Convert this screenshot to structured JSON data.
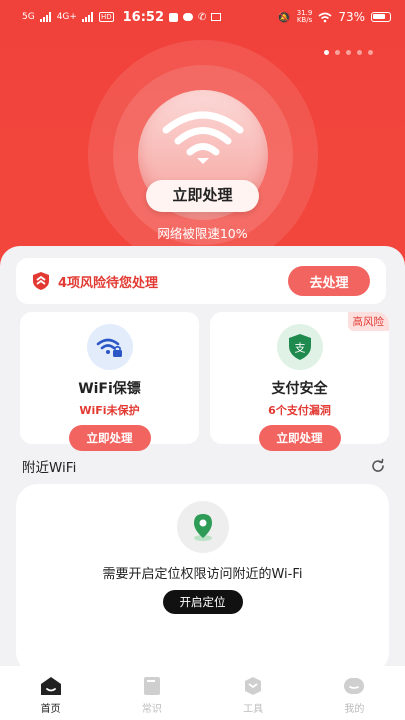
{
  "status_bar": {
    "signal_1": "5G",
    "signal_2": "4G+",
    "hd": "HD",
    "time": "16:52",
    "net_speed_value": "31.9",
    "net_speed_unit": "KB/s",
    "battery": "73%"
  },
  "hero": {
    "pager_total": 5,
    "pager_active": 0,
    "process_button": "立即处理",
    "speed_status": "网络被限速10%"
  },
  "risk": {
    "text": "4项风险待您处理",
    "button": "去处理"
  },
  "cards": [
    {
      "title": "WiFi保镖",
      "subtitle": "WiFi未保护",
      "button": "立即处理",
      "badge": ""
    },
    {
      "title": "支付安全",
      "subtitle": "6个支付漏洞",
      "button": "立即处理",
      "badge": "高风险",
      "icon_glyph": "支"
    }
  ],
  "nearby": {
    "title": "附近WiFi",
    "message": "需要开启定位权限访问附近的Wi-Fi",
    "button": "开启定位"
  },
  "tabs": [
    {
      "label": "首页",
      "active": true
    },
    {
      "label": "常识",
      "active": false
    },
    {
      "label": "工具",
      "active": false
    },
    {
      "label": "我的",
      "active": false
    }
  ],
  "colors": {
    "brand_red": "#f2463d",
    "button_red": "#f2645f",
    "alert_red": "#e23a33",
    "pay_green": "#1e8a4e"
  }
}
